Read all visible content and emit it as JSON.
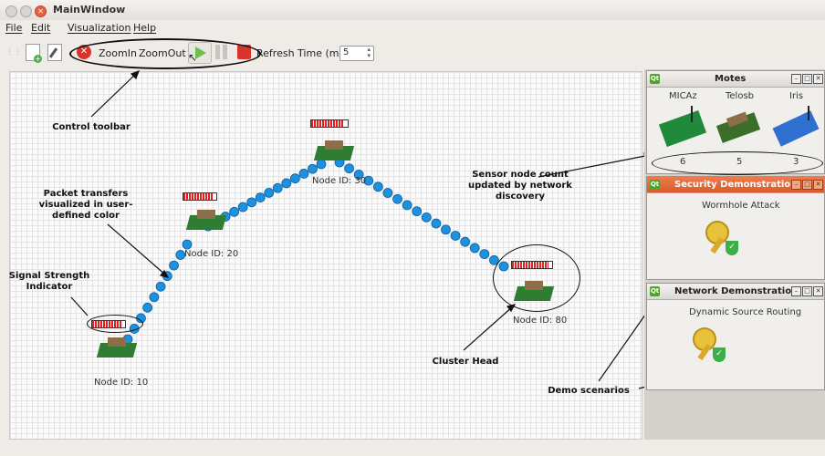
{
  "window": {
    "title": "MainWindow"
  },
  "menu": [
    "File",
    "Edit",
    "Visualization",
    "Help"
  ],
  "toolbar": {
    "zoomin": "ZoomIn",
    "zoomout": "ZoomOut",
    "refresh_label": "Refresh Time (mSec)",
    "refresh_value": "5"
  },
  "nodes": [
    {
      "label": "Node ID: 10",
      "signal": 0.9
    },
    {
      "label": "Node ID: 20",
      "signal": 0.9
    },
    {
      "label": "Node ID: 30",
      "signal": 0.9
    },
    {
      "label": "Node ID: 80",
      "signal": 0.9
    }
  ],
  "annotations": {
    "control_toolbar": "Control toolbar",
    "packet_transfers": "Packet transfers visualized in user-defined color",
    "signal_strength": "Signal Strength Indicator",
    "cluster_head": "Cluster Head",
    "sensor_count": "Sensor node count updated by network discovery",
    "demo_scenarios": "Demo scenarios"
  },
  "motes_panel": {
    "title": "Motes",
    "types": [
      {
        "name": "MICAz",
        "count": "6"
      },
      {
        "name": "Telosb",
        "count": "5"
      },
      {
        "name": "Iris",
        "count": "3"
      }
    ]
  },
  "security_panel": {
    "title": "Security Demonstration",
    "item": "Wormhole Attack"
  },
  "network_panel": {
    "title": "Network Demonstration",
    "item": "Dynamic Source Routing"
  },
  "colors": {
    "packet": "#1e90e0",
    "signal": "#dd2222",
    "accent_orange": "#e86a3a"
  }
}
